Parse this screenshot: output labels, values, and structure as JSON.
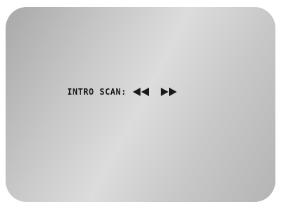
{
  "screen": {
    "osd_label": "INTRO SCAN:",
    "rewind_icon": "double-left-triangle",
    "fast_forward_icon": "double-right-triangle",
    "text_color": "#1a1a1a"
  }
}
